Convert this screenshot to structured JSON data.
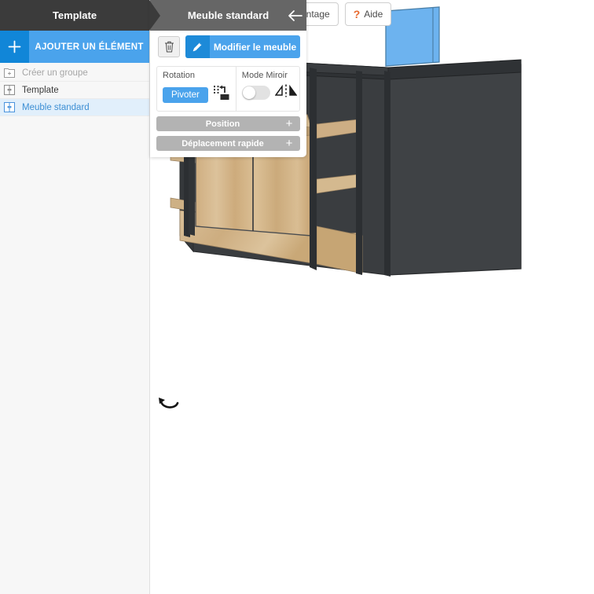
{
  "sidebar": {
    "title": "Template",
    "add_button": {
      "plus_icon": "plus-icon",
      "label": "AJOUTER UN ÉLÉMENT"
    },
    "tree": [
      {
        "icon": "folder-plus-icon",
        "label": "Créer un groupe",
        "state": "disabled"
      },
      {
        "icon": "cabinet-icon",
        "label": "Template",
        "state": "normal"
      },
      {
        "icon": "cabinet-icon",
        "label": "Meuble standard",
        "state": "selected"
      }
    ]
  },
  "properties": {
    "header_title": "Meuble standard",
    "back_icon": "arrow-left-icon",
    "toolbar": {
      "delete_icon": "trash-icon",
      "edit_icon": "pencil-icon",
      "edit_label": "Modifier le meuble"
    },
    "rotation": {
      "title": "Rotation",
      "button_label": "Pivoter",
      "icon": "rotate-object-icon"
    },
    "mirror": {
      "title": "Mode Miroir",
      "toggle_state": "off",
      "icon": "mirror-icon"
    },
    "collapsible": [
      {
        "label": "Position",
        "expand_icon": "plus-icon"
      },
      {
        "label": "Déplacement rapide",
        "expand_icon": "plus-icon"
      }
    ]
  },
  "top_right": {
    "montage": {
      "label": "ontage",
      "full_label": "Montage"
    },
    "help": {
      "icon": "question-icon",
      "label": "Aide"
    }
  },
  "viewport": {
    "rotate_handle_icon": "rotate-arrow-icon",
    "background": "#ffffff"
  },
  "colors": {
    "accent_blue": "#4aa3ec",
    "accent_blue_dark": "#1186d8",
    "header_dark": "#3b3b3b",
    "header_gray": "#666666",
    "panel_gray": "#b3b3b3",
    "selected_row": "#e1effb",
    "model_body": "#3f4245",
    "model_wood": "#d3b286",
    "model_selected_panel": "#6db3ef",
    "help_orange": "#e8692e"
  }
}
